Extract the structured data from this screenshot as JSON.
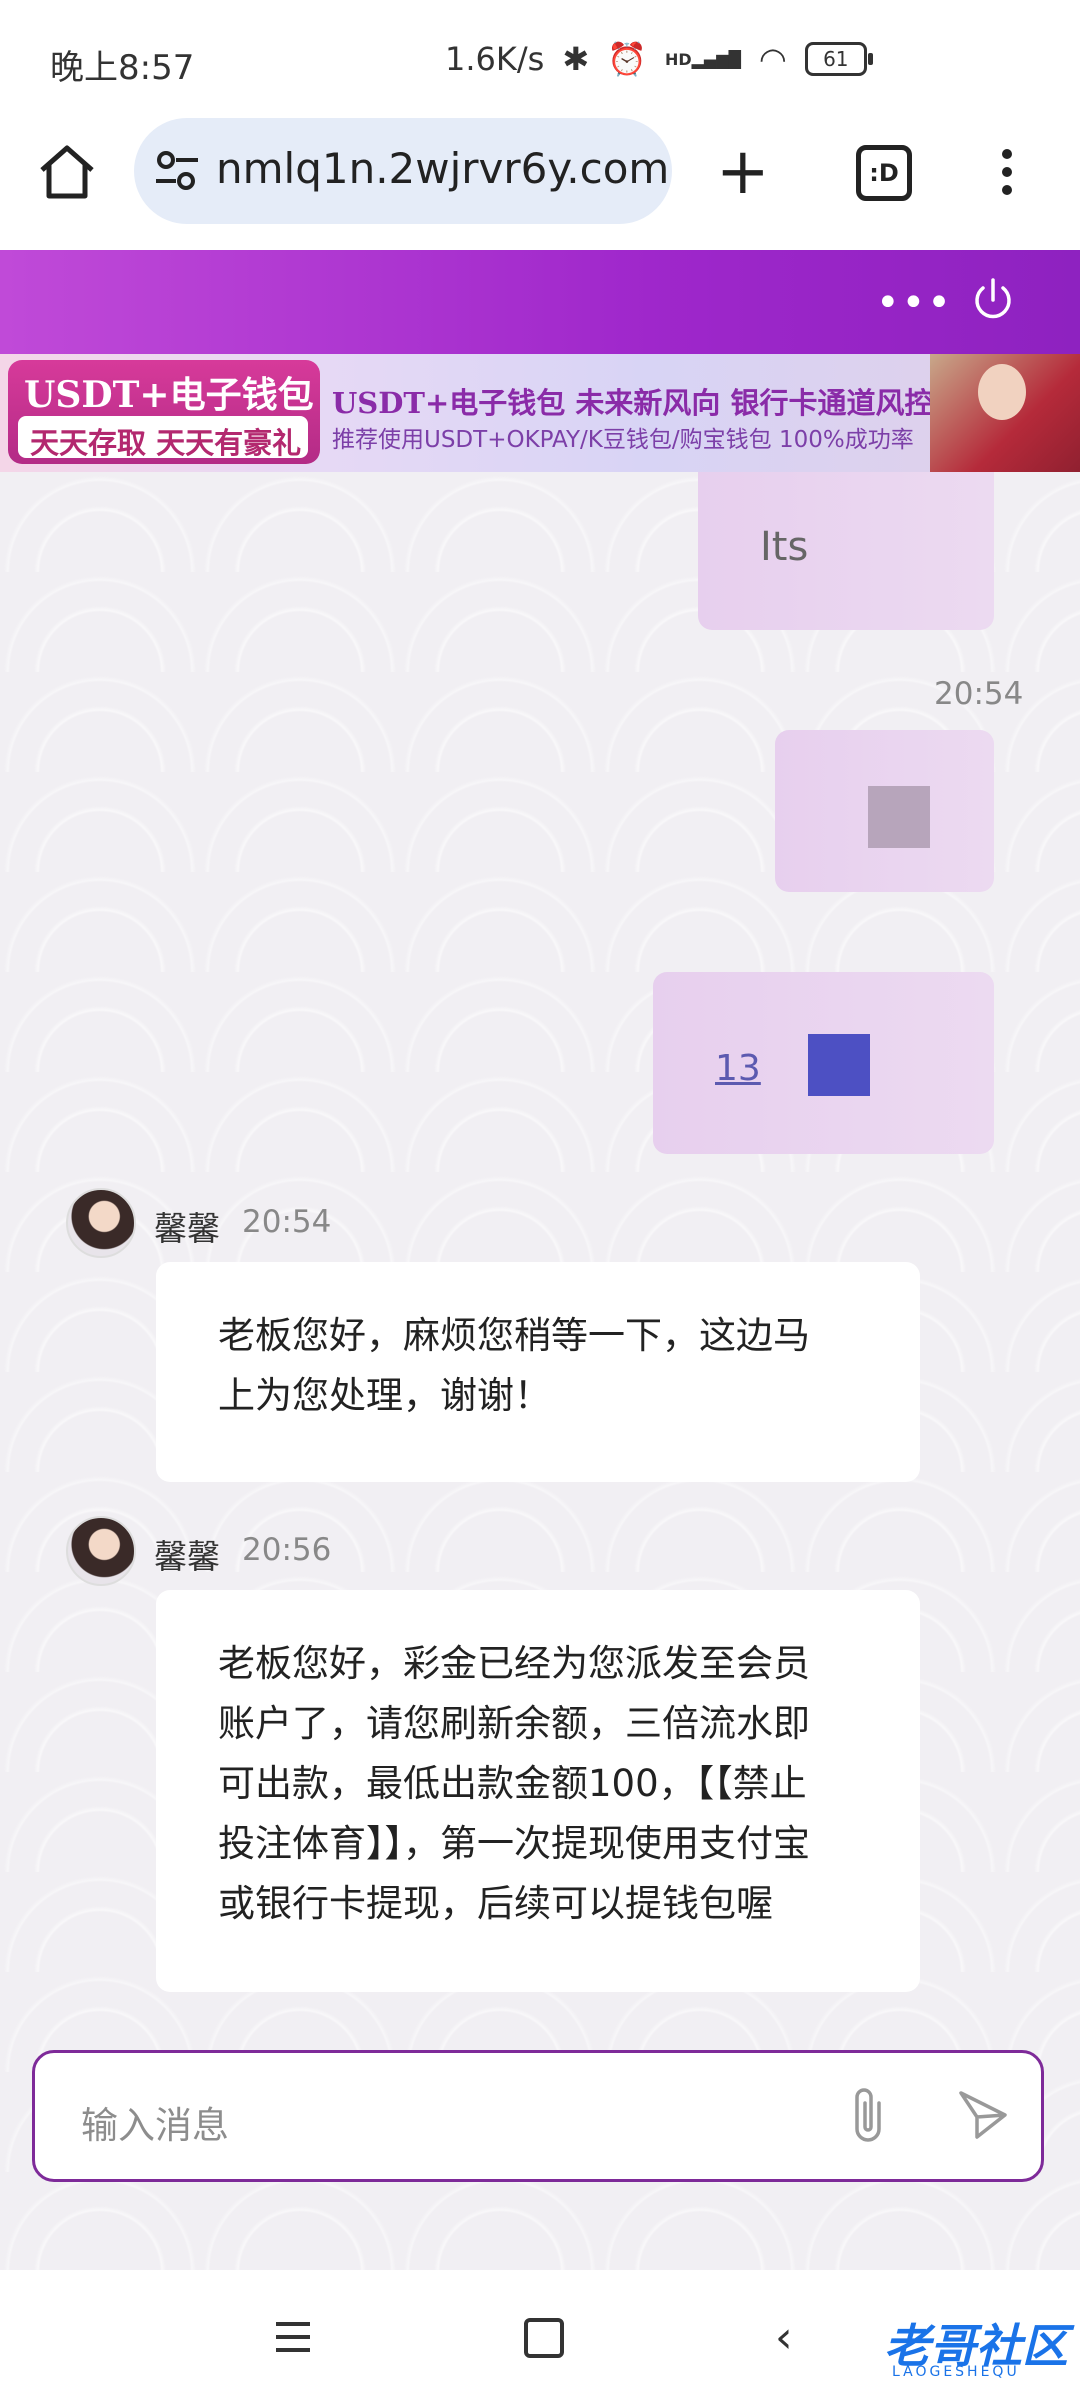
{
  "status_bar": {
    "time": "晚上8:57",
    "net_speed": "1.6K/s",
    "network": "HD",
    "battery": "61"
  },
  "browser": {
    "url": "nmlq1n.2wjrvr6y.com",
    "tab_button": ":D"
  },
  "banner": {
    "tag_title": "USDT+电子钱包",
    "tag_sub": "天天存取 天天有豪礼",
    "headline": "USDT+电子钱包  未来新风向  银行卡通道风控厉害",
    "subline": "推荐使用USDT+OKPAY/K豆钱包/购宝钱包   100%成功率"
  },
  "messages": {
    "out1_text": "Its",
    "out_timestamp": "20:54",
    "out3_text": "13",
    "in1": {
      "sender": "馨馨",
      "time": "20:54",
      "lines": [
        "老板您好，麻烦您稍等一下，这边马",
        "上为您处理，谢谢！"
      ]
    },
    "in2": {
      "sender": "馨馨",
      "time": "20:56",
      "lines": [
        "老板您好，彩金已经为您派发至会员",
        "账户了，请您刷新余额，三倍流水即",
        "可出款，最低出款金额100，【【禁止",
        "投注体育】】，第一次提现使用支付宝",
        "或银行卡提现，后续可以提钱包喔"
      ]
    }
  },
  "input": {
    "placeholder": "输入消息"
  },
  "watermark": {
    "text": "老哥社区",
    "sub": "LAOGESHEQU"
  },
  "colors": {
    "header_gradient_start": "#c04ad8",
    "header_gradient_end": "#8e22c0",
    "outgoing_bubble": "#e9d3ef",
    "input_border": "#7e2a99"
  }
}
